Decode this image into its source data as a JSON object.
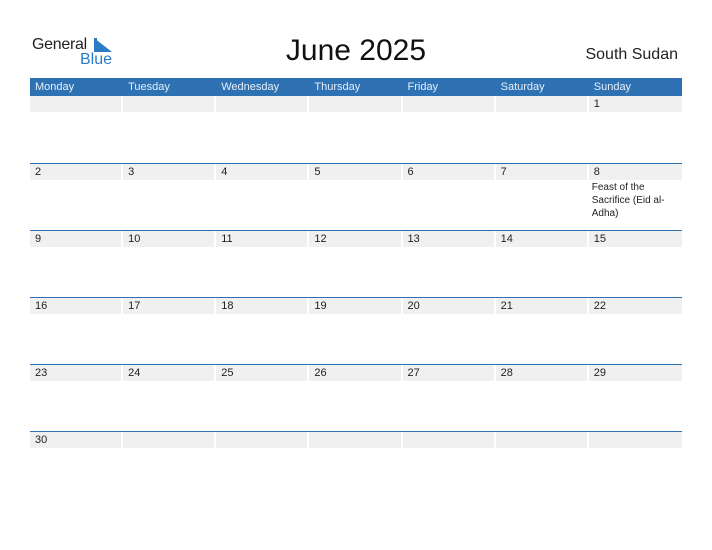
{
  "logo": {
    "text_general": "General",
    "text_blue": "Blue"
  },
  "header": {
    "title": "June 2025",
    "country": "South Sudan"
  },
  "calendar": {
    "weekdays": [
      "Monday",
      "Tuesday",
      "Wednesday",
      "Thursday",
      "Friday",
      "Saturday",
      "Sunday"
    ],
    "weeks": [
      [
        {
          "day": ""
        },
        {
          "day": ""
        },
        {
          "day": ""
        },
        {
          "day": ""
        },
        {
          "day": ""
        },
        {
          "day": ""
        },
        {
          "day": "1"
        }
      ],
      [
        {
          "day": "2"
        },
        {
          "day": "3"
        },
        {
          "day": "4"
        },
        {
          "day": "5"
        },
        {
          "day": "6"
        },
        {
          "day": "7"
        },
        {
          "day": "8",
          "event": "Feast of the Sacrifice (Eid al-Adha)"
        }
      ],
      [
        {
          "day": "9"
        },
        {
          "day": "10"
        },
        {
          "day": "11"
        },
        {
          "day": "12"
        },
        {
          "day": "13"
        },
        {
          "day": "14"
        },
        {
          "day": "15"
        }
      ],
      [
        {
          "day": "16"
        },
        {
          "day": "17"
        },
        {
          "day": "18"
        },
        {
          "day": "19"
        },
        {
          "day": "20"
        },
        {
          "day": "21"
        },
        {
          "day": "22"
        }
      ],
      [
        {
          "day": "23"
        },
        {
          "day": "24"
        },
        {
          "day": "25"
        },
        {
          "day": "26"
        },
        {
          "day": "27"
        },
        {
          "day": "28"
        },
        {
          "day": "29"
        }
      ],
      [
        {
          "day": "30"
        },
        {
          "day": ""
        },
        {
          "day": ""
        },
        {
          "day": ""
        },
        {
          "day": ""
        },
        {
          "day": ""
        },
        {
          "day": ""
        }
      ]
    ]
  },
  "colors": {
    "accent": "#2e72b4",
    "logo_blue": "#2a7cc7",
    "date_strip": "#f0f0f0"
  }
}
